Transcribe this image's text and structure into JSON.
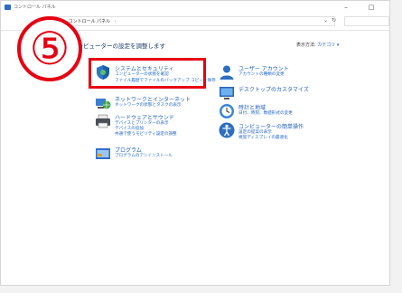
{
  "window": {
    "title": "コントロール パネル",
    "minimize_glyph": "–",
    "maximize_glyph": "□",
    "address_path": [
      "コントロール パネル"
    ],
    "chevron_glyph": "›",
    "dropdown_glyph": "⌄",
    "refresh_glyph": "↻"
  },
  "annotation": {
    "number": "⑤",
    "color": "#e60012"
  },
  "main": {
    "heading": "コンピューターの設定を調整します",
    "view_by_label": "表示方法:",
    "view_by_value": "カテゴリ ▾"
  },
  "categories": {
    "system_security": {
      "title": "システムとセキュリティ",
      "links": [
        "コンピューターの状態を確認",
        "ファイル履歴でファイルのバックアップ コピーを保存"
      ]
    },
    "network": {
      "title": "ネットワークとインターネット",
      "links": [
        "ネットワークの状態とタスクの表示"
      ]
    },
    "hardware": {
      "title": "ハードウェアとサウンド",
      "links": [
        "デバイスとプリンターの表示",
        "デバイスの追加",
        "共通で使うモビリティ設定の調整"
      ]
    },
    "programs": {
      "title": "プログラム",
      "links": [
        "プログラムのアンインストール"
      ]
    },
    "user_accounts": {
      "title": "ユーザー アカウント",
      "links": [
        "アカウントの種類の変更"
      ]
    },
    "appearance": {
      "title": "デスクトップのカスタマイズ",
      "links": []
    },
    "clock_region": {
      "title": "時計と地域",
      "links": [
        "日付、時刻、数値形式の変更"
      ]
    },
    "ease_of_access": {
      "title": "コンピューターの簡単操作",
      "links": [
        "設定の提案の表示",
        "視覚ディスプレイの最適化"
      ]
    }
  },
  "colors": {
    "link": "#1e64c8",
    "title_link": "#1e5fbf",
    "highlight": "#e60012"
  },
  "icons": {
    "system_security": "shield-icon",
    "network": "globe-network-icon",
    "hardware": "printer-icon",
    "programs": "programs-icon",
    "user_accounts": "user-icon",
    "appearance": "monitor-icon",
    "clock_region": "clock-globe-icon",
    "ease_of_access": "accessibility-icon"
  }
}
